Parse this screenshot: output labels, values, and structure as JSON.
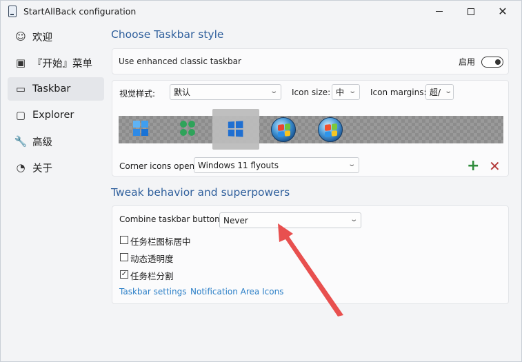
{
  "window": {
    "title": "StartAllBack configuration",
    "minimize_label": "",
    "maximize_label": "",
    "close_label": "✕"
  },
  "sidebar": {
    "items": [
      {
        "label": "欢迎",
        "icon": "smiley-icon",
        "glyph": "☺"
      },
      {
        "label": "『开始』菜单",
        "icon": "start-menu-icon",
        "glyph": "▣"
      },
      {
        "label": "Taskbar",
        "icon": "taskbar-icon",
        "glyph": "▭",
        "active": true
      },
      {
        "label": "Explorer",
        "icon": "folder-icon",
        "glyph": "▢"
      },
      {
        "label": "高级",
        "icon": "wrench-icon",
        "glyph": "🔧"
      },
      {
        "label": "关于",
        "icon": "gauge-icon",
        "glyph": "◔"
      }
    ]
  },
  "taskbar_style": {
    "section_title": "Choose Taskbar style",
    "enhanced_label": "Use enhanced classic taskbar",
    "enhanced_toggle_label": "启用",
    "enhanced_on": true,
    "visual_style_label": "视觉样式:",
    "visual_style_value": "默认",
    "icon_size_label": "Icon size:",
    "icon_size_value": "中",
    "icon_margins_label": "Icon margins:",
    "icon_margins_value": "超/",
    "styles": [
      "windows-11-icon",
      "clover-icon",
      "windows-10-icon",
      "windows-7-orb-icon",
      "windows-vista-orb-icon"
    ],
    "selected_style_index": 2,
    "corner_icons_label": "Corner icons open:",
    "corner_icons_value": "Windows 11 flyouts",
    "add_glyph": "+",
    "remove_glyph": "✕"
  },
  "tweak": {
    "section_title": "Tweak behavior and superpowers",
    "combine_label": "Combine taskbar buttons:",
    "combine_value": "Never",
    "checkboxes": [
      {
        "label": "任务栏图标居中",
        "checked": false
      },
      {
        "label": "动态透明度",
        "checked": false
      },
      {
        "label": "任务栏分割",
        "checked": true
      }
    ],
    "links": [
      "Taskbar settings",
      "Notification Area Icons"
    ]
  },
  "colors": {
    "accent": "#2f5f9c",
    "link": "#2b7fc7",
    "add": "#2e8b3a",
    "remove": "#b43a3a",
    "annotation_arrow": "#e8504f"
  }
}
